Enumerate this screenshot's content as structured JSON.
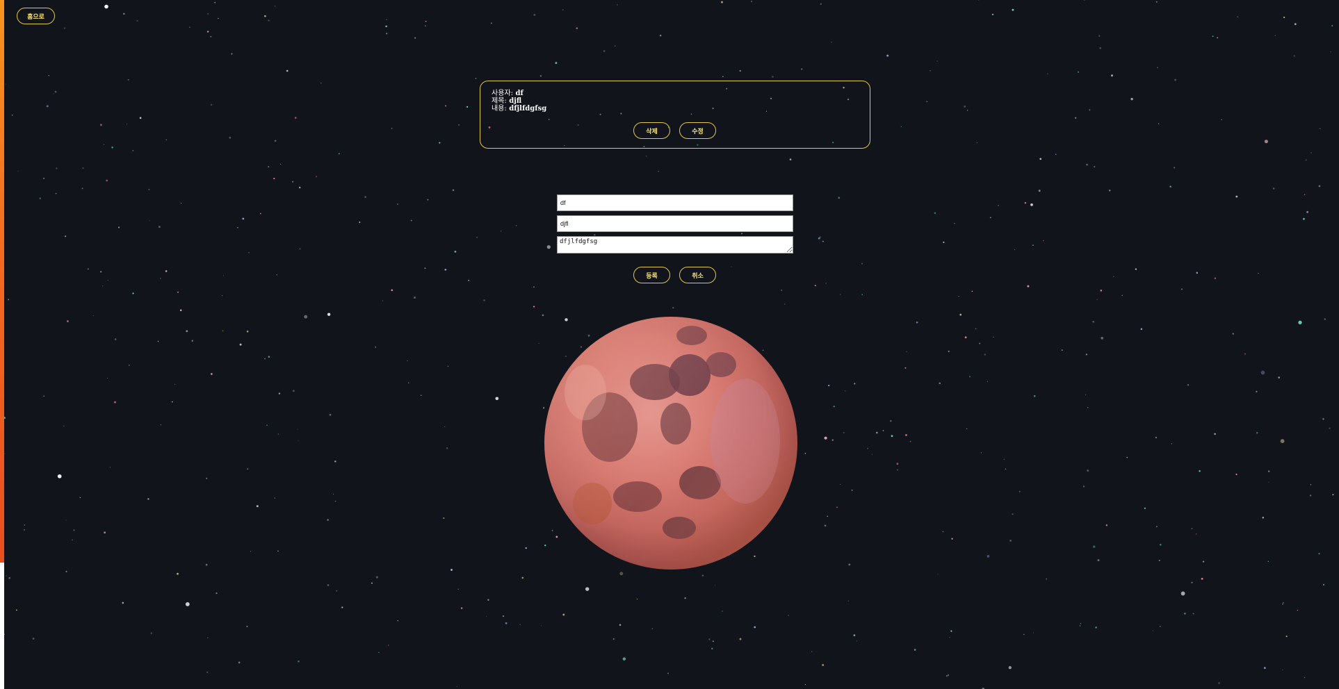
{
  "nav": {
    "home_label": "홈으로"
  },
  "post": {
    "user_label": "사용자:",
    "user_value": "df",
    "title_label": "제목:",
    "title_value": "djfl",
    "content_label": "내용:",
    "content_value": "dfjlfdgfsg",
    "delete_label": "삭제",
    "edit_label": "수정"
  },
  "form": {
    "user_value": "df",
    "title_value": "djfl",
    "content_value": "dfjlfdgfsg",
    "submit_label": "등록",
    "cancel_label": "취소"
  },
  "colors": {
    "accent": "#e3c84a",
    "background": "#11141a",
    "button_text": "#f6e27a"
  },
  "icons": {
    "moon": "moon-image"
  }
}
